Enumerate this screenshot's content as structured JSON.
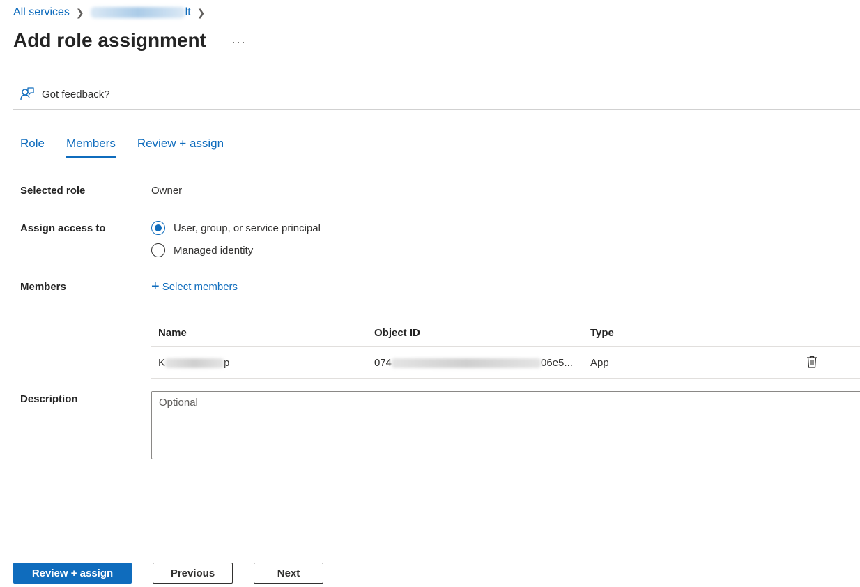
{
  "breadcrumb": {
    "root": "All services",
    "tail_char": "lt"
  },
  "page": {
    "title": "Add role assignment",
    "more": "···"
  },
  "feedback": {
    "label": "Got feedback?"
  },
  "tabs": [
    {
      "label": "Role"
    },
    {
      "label": "Members"
    },
    {
      "label": "Review + assign"
    }
  ],
  "form": {
    "selected_role_label": "Selected role",
    "selected_role_value": "Owner",
    "assign_access_label": "Assign access to",
    "assign_options": [
      {
        "label": "User, group, or service principal"
      },
      {
        "label": "Managed identity"
      }
    ],
    "members_label": "Members",
    "select_members": "Select members",
    "description_label": "Description",
    "description_placeholder": "Optional"
  },
  "members_table": {
    "headers": {
      "name": "Name",
      "object_id": "Object ID",
      "type": "Type"
    },
    "rows": [
      {
        "name_prefix": "K",
        "name_suffix": "p",
        "oid_prefix": "074",
        "oid_suffix": "06e5...",
        "type": "App"
      }
    ]
  },
  "buttons": {
    "review_assign": "Review + assign",
    "previous": "Previous",
    "next": "Next"
  },
  "colors": {
    "accent": "#0f6cbd",
    "text": "#323130"
  }
}
